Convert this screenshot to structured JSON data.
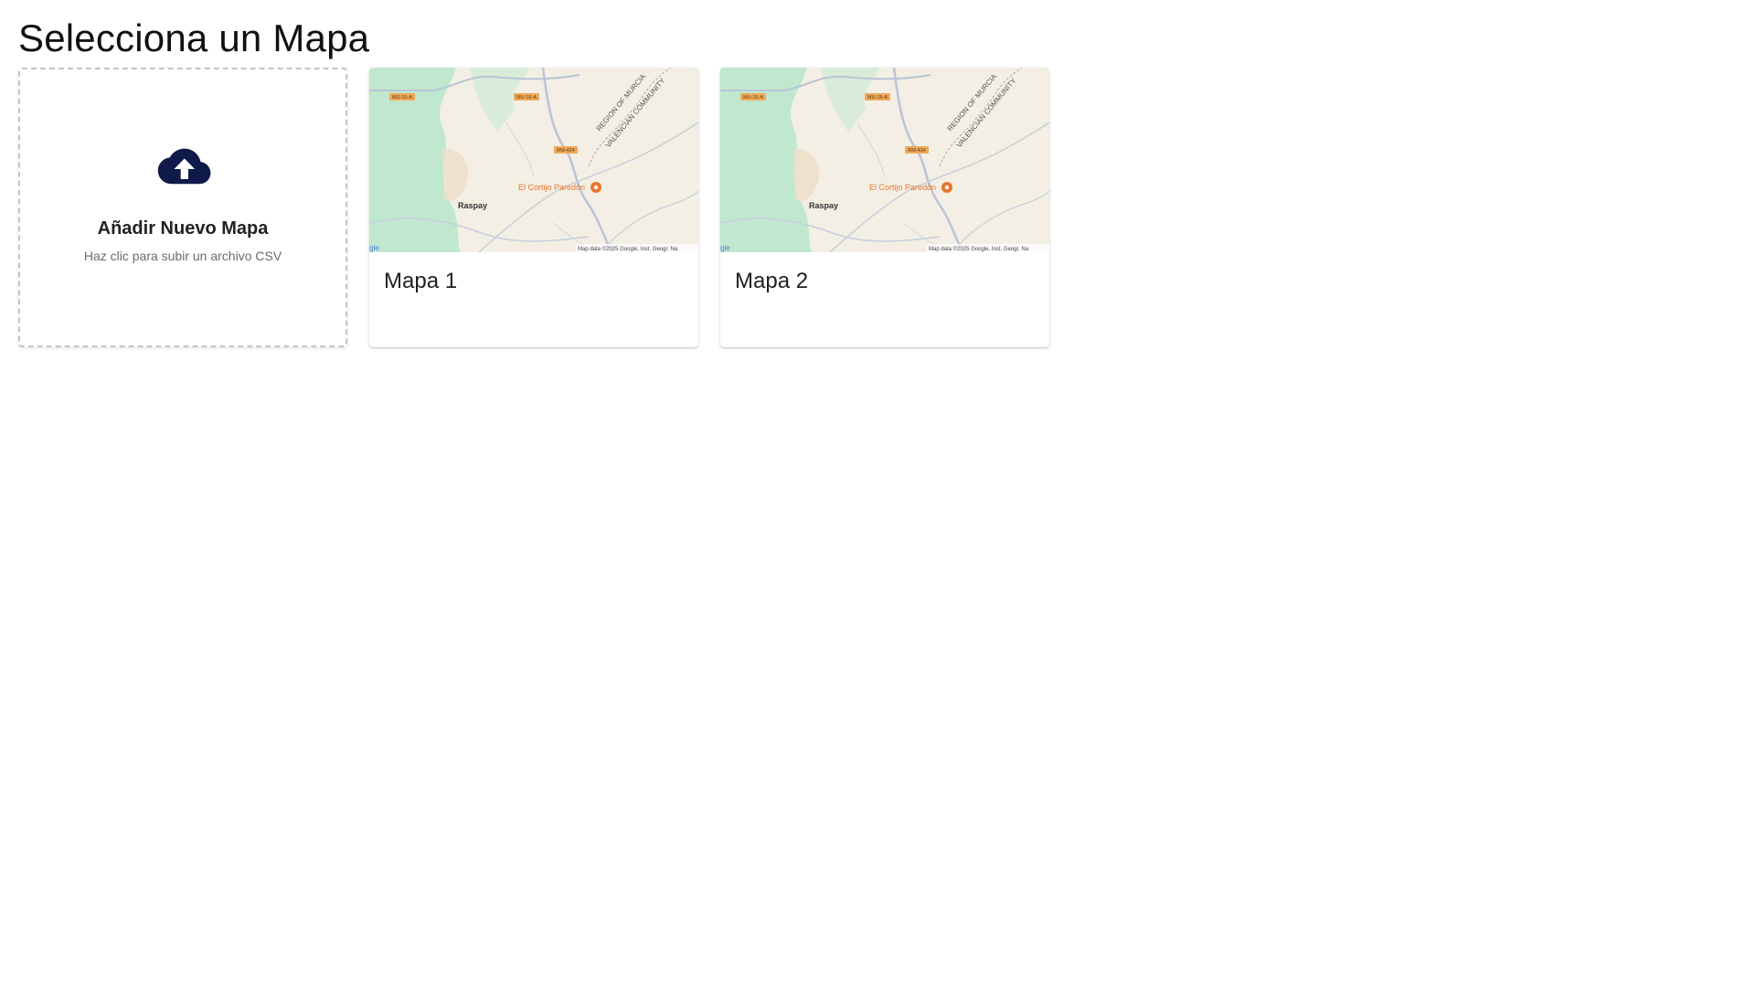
{
  "page": {
    "title": "Selecciona un Mapa"
  },
  "add_card": {
    "icon": "cloud-upload-icon",
    "title": "Añadir Nuevo Mapa",
    "subtitle": "Haz clic para subir un archivo CSV"
  },
  "maps": [
    {
      "name": "Mapa 1",
      "thumbnail": {
        "road_labels": [
          "MU-15-A",
          "MU-15-A",
          "RM-434"
        ],
        "region_label_line1": "REGION OF MURCIA",
        "region_label_line2": "VALENCIAN COMMUNITY",
        "town_label": "Raspay",
        "poi_label": "El Cortijo Paredón",
        "google_logo": "gle",
        "attribution": "Map data ©2025 Google, Inst. Geogr. Na"
      }
    },
    {
      "name": "Mapa 2",
      "thumbnail": {
        "road_labels": [
          "MU-15-A",
          "MU-15-A",
          "RM-434"
        ],
        "region_label_line1": "REGION OF MURCIA",
        "region_label_line2": "VALENCIAN COMMUNITY",
        "town_label": "Raspay",
        "poi_label": "El Cortijo Paredón",
        "google_logo": "gle",
        "attribution": "Map data ©2025 Google, Inst. Geogr. Na"
      }
    }
  ],
  "colors": {
    "upload_icon": "#0f1a4a",
    "map_land": "#f3efe5",
    "map_forest": "#bfe8cf",
    "map_roads": "#b9c4d6",
    "poi_orange": "#e8762b",
    "road_badge": "#f0a85a"
  }
}
